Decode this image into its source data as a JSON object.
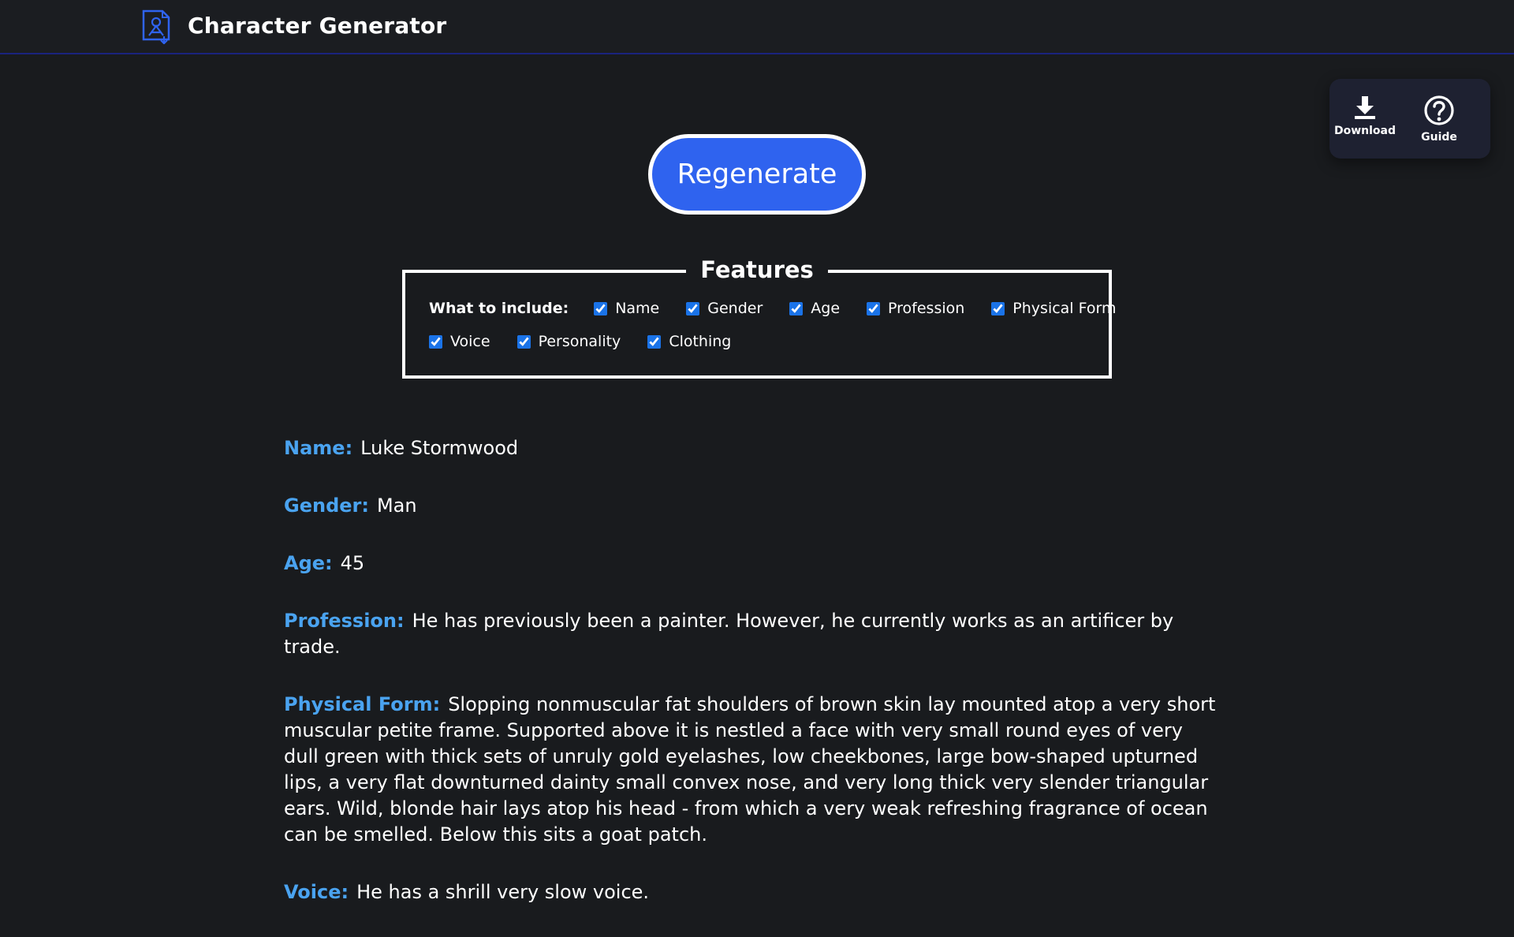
{
  "header": {
    "title": "Character Generator"
  },
  "tools": {
    "download_label": "Download",
    "guide_label": "Guide"
  },
  "actions": {
    "regenerate_label": "Regenerate"
  },
  "features": {
    "legend": "Features",
    "prompt": "What to include:",
    "options": [
      {
        "label": "Name",
        "checked": true
      },
      {
        "label": "Gender",
        "checked": true
      },
      {
        "label": "Age",
        "checked": true
      },
      {
        "label": "Profession",
        "checked": true
      },
      {
        "label": "Physical Form",
        "checked": true
      },
      {
        "label": "Voice",
        "checked": true
      },
      {
        "label": "Personality",
        "checked": true
      },
      {
        "label": "Clothing",
        "checked": true
      }
    ]
  },
  "character": [
    {
      "key": "Name:",
      "value": "Luke Stormwood"
    },
    {
      "key": "Gender:",
      "value": "Man"
    },
    {
      "key": "Age:",
      "value": "45"
    },
    {
      "key": "Profession:",
      "value": "He has previously been a painter. However, he currently works as an artificer by trade."
    },
    {
      "key": "Physical Form:",
      "value": "Slopping nonmuscular fat shoulders of brown skin lay mounted atop a very short muscular petite frame. Supported above it is nestled a face with very small round eyes of very dull green with thick sets of unruly gold eyelashes, low cheekbones, large bow-shaped upturned lips, a very flat downturned dainty small convex nose, and very long thick very slender triangular ears. Wild, blonde hair lays atop his head - from which a very weak refreshing fragrance of ocean can be smelled. Below this sits a goat patch."
    },
    {
      "key": "Voice:",
      "value": "He has a shrill very slow voice."
    }
  ],
  "colors": {
    "accent": "#2f63ef",
    "label": "#4aa3f0",
    "background": "#191b1e"
  },
  "icons": {
    "brand": "character-sheet-icon",
    "download": "download-icon",
    "guide": "help-circle-icon"
  }
}
